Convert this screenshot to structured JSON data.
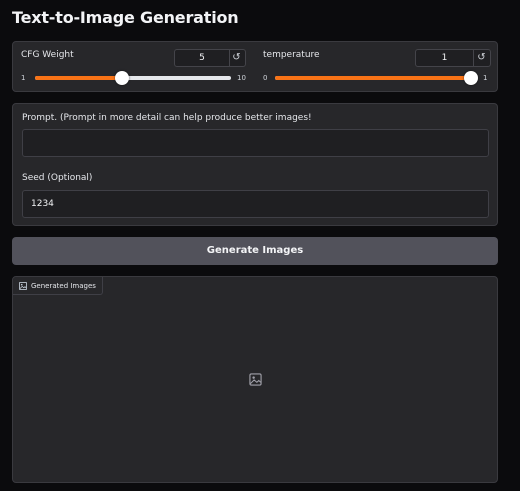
{
  "page": {
    "title": "Text-to-Image Generation"
  },
  "sliders": {
    "cfg": {
      "label": "CFG Weight",
      "value": "5",
      "min": "1",
      "max": "10",
      "fraction": 0.444,
      "reset_icon": "reset-icon"
    },
    "temperature": {
      "label": "temperature",
      "value": "1",
      "min": "0",
      "max": "1",
      "fraction": 1.0,
      "reset_icon": "reset-icon"
    }
  },
  "prompt": {
    "label": "Prompt. (Prompt in more detail can help produce better images!",
    "value": ""
  },
  "seed": {
    "label": "Seed (Optional)",
    "value": "1234"
  },
  "generate": {
    "label": "Generate Images"
  },
  "output": {
    "tab_label": "Generated Images",
    "tab_icon": "image-icon",
    "placeholder_icon": "image-placeholder-icon"
  },
  "colors": {
    "accent": "#f97316",
    "panel": "#27272a",
    "background": "#0b0b0d",
    "button": "#52525b"
  }
}
